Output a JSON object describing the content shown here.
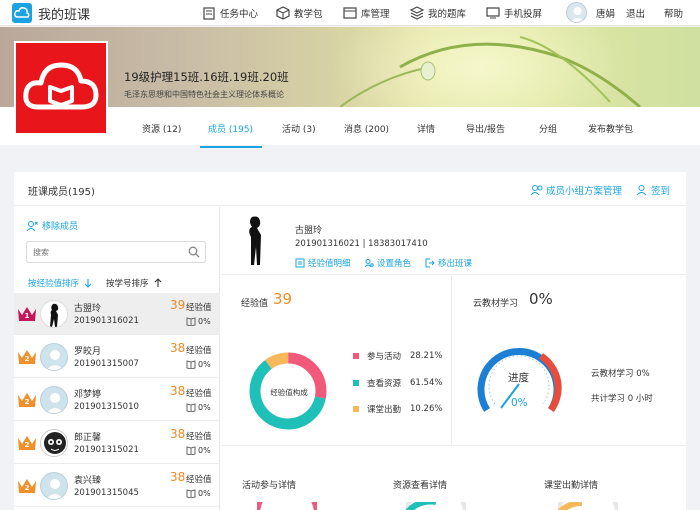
{
  "app": {
    "title": "我的班课"
  },
  "topnav": [
    {
      "label": "任务中心",
      "icon": "task-icon"
    },
    {
      "label": "教学包",
      "icon": "package-icon"
    },
    {
      "label": "库管理",
      "icon": "library-icon"
    },
    {
      "label": "我的题库",
      "icon": "question-bank-icon"
    },
    {
      "label": "手机投屏",
      "icon": "screen-cast-icon"
    }
  ],
  "user": {
    "name": "唐娟",
    "logout": "退出",
    "help": "帮助"
  },
  "course": {
    "title": "19级护理15班.16班.19班.20班",
    "subtitle": "毛泽东思想和中国特色社会主义理论体系概论"
  },
  "tabs": [
    {
      "label": "资源 (12)"
    },
    {
      "label": "成员 (195)",
      "active": true
    },
    {
      "label": "活动 (3)"
    },
    {
      "label": "消息 (200)"
    },
    {
      "label": "详情"
    },
    {
      "label": "导出/报告"
    },
    {
      "label": "分组"
    },
    {
      "label": "发布教学包"
    }
  ],
  "members": {
    "title": "班课成员(195)",
    "group_plan": "成员小组方案管理",
    "sign_in": "签到",
    "remove": "移除成员",
    "search_placeholder": "搜索",
    "sort_exp": "按经验值排序",
    "sort_id": "按学号排序",
    "list": [
      {
        "rank": "1",
        "name": "古盟玲",
        "id": "201901316021",
        "score": "39",
        "score_label": "经验值",
        "pct": "0%"
      },
      {
        "rank": "2",
        "name": "罗皎月",
        "id": "201901315007",
        "score": "38",
        "score_label": "经验值",
        "pct": "0%"
      },
      {
        "rank": "2",
        "name": "邓梦婷",
        "id": "201901315010",
        "score": "38",
        "score_label": "经验值",
        "pct": "0%"
      },
      {
        "rank": "2",
        "name": "郎正馨",
        "id": "201901315021",
        "score": "38",
        "score_label": "经验值",
        "pct": "0%"
      },
      {
        "rank": "2",
        "name": "袁兴臻",
        "id": "201901315045",
        "score": "38",
        "score_label": "经验值",
        "pct": "0%"
      }
    ]
  },
  "profile": {
    "name": "古盟玲",
    "id_phone": "201901316021 | 18383017410",
    "actions": [
      "经验值明细",
      "设置角色",
      "移出班课"
    ]
  },
  "exp_panel": {
    "title": "经验值",
    "value": "39",
    "center": "经验值构成",
    "legend": [
      {
        "label": "参与活动",
        "pct": "28.21%",
        "color": "#f0597a",
        "value": 28.21
      },
      {
        "label": "查看资源",
        "pct": "61.54%",
        "color": "#1fc0b8",
        "value": 61.54
      },
      {
        "label": "课堂出勤",
        "pct": "10.26%",
        "color": "#f7b85a",
        "value": 10.26
      }
    ]
  },
  "cloud_panel": {
    "title": "云教材学习",
    "value": "0%",
    "gauge_label": "进度",
    "gauge_value": "0%",
    "progress": 0,
    "stat1": "云教材学习 0%",
    "stat2": "共计学习 0 小时"
  },
  "bottom": [
    "活动参与详情",
    "资源查看详情",
    "课堂出勤详情"
  ]
}
